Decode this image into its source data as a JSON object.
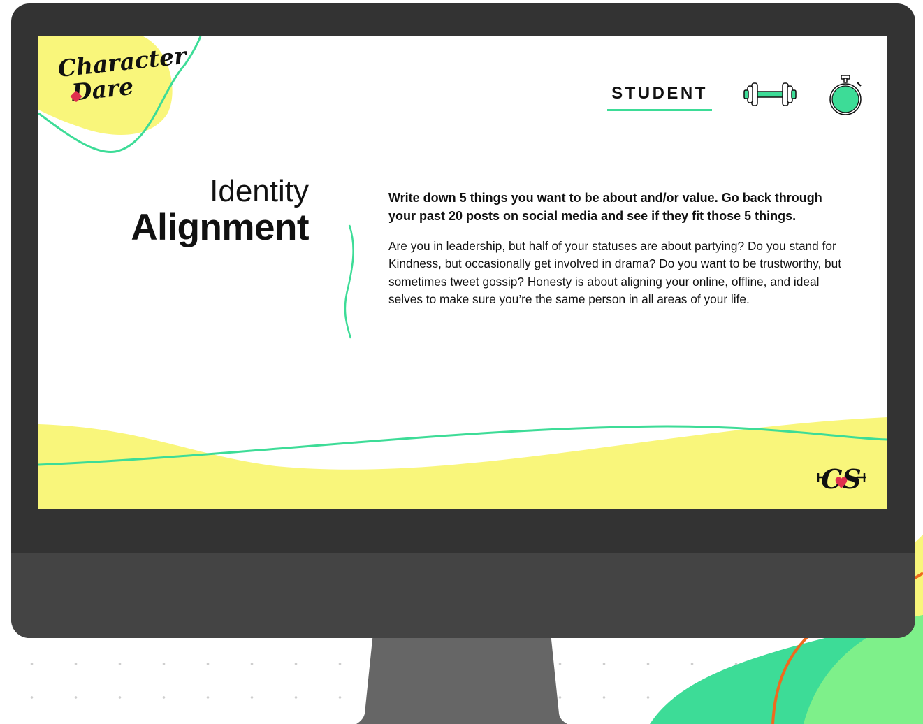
{
  "brand": {
    "logo_line1": "Character",
    "logo_line2": "Dare",
    "footer_logo": "CS"
  },
  "nav": {
    "student_label": "STUDENT",
    "icons": [
      "dumbbell-icon",
      "stopwatch-icon"
    ]
  },
  "slide": {
    "title_line1": "Identity",
    "title_line2": "Alignment",
    "lead": "Write down 5 things you want to be about and/or value. Go back through your past 20 posts on social media and see if they fit those 5 things.",
    "body": "Are you in leadership, but half of your statuses are about partying? Do you stand for Kindness, but occasionally get involved in drama? Do you want to be trustworthy, but sometimes tweet gossip? Honesty is about aligning your online, offline, and ideal selves to make sure you’re the same person in all areas of your life."
  },
  "colors": {
    "accent_green": "#3ddc97",
    "accent_yellow": "#f9f67b",
    "heart_red": "#e0304e",
    "monitor_frame": "#333333",
    "monitor_chin": "#444444",
    "stand": "#666666",
    "orange_line": "#ee6a1f"
  }
}
